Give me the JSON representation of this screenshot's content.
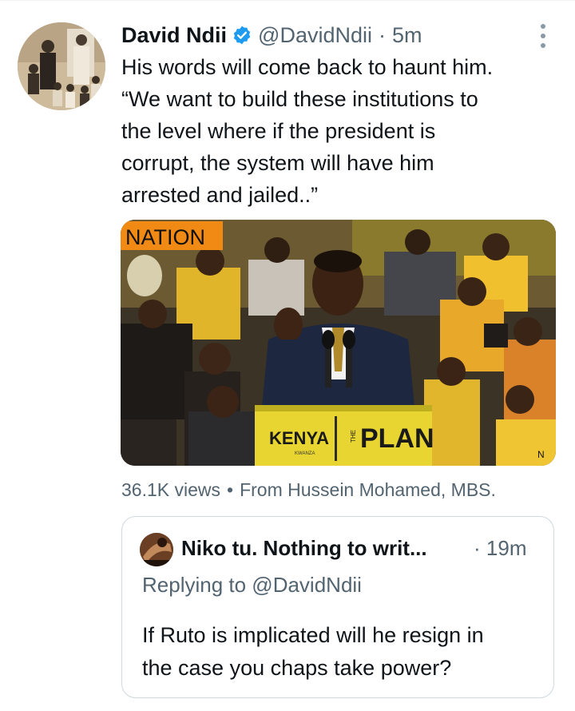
{
  "tweet": {
    "author_name": "David Ndii",
    "author_handle": "@DavidNdii",
    "separator": "·",
    "time": "5m",
    "verified_icon": "verified-badge-icon",
    "more_icon": "more-options-icon",
    "text_lines": [
      "His words will come back to haunt him.",
      "“We want to build these institutions to",
      "the level where if the president is",
      "corrupt, the system will have him",
      "arrested and jailed..”"
    ],
    "media": {
      "watermark": "NATION",
      "podium_left": "KENYA",
      "podium_sub": "KWANZA",
      "podium_right_prefix": "THE",
      "podium_right": "PLAN",
      "corner_mark": "N"
    },
    "views": "36.1K views",
    "bullet": "•",
    "source": "From Hussein Mohamed, MBS."
  },
  "quote": {
    "author_name": "Niko tu. Nothing to writ...",
    "separator": "·",
    "time": "19m",
    "replying_to": "Replying to @DavidNdii",
    "text_lines": [
      "If Ruto is implicated will he resign in",
      "the case you chaps take power?"
    ]
  },
  "colors": {
    "brand_blue": "#1d9bf0",
    "secondary_text": "#536471",
    "border": "#cfd9de"
  }
}
